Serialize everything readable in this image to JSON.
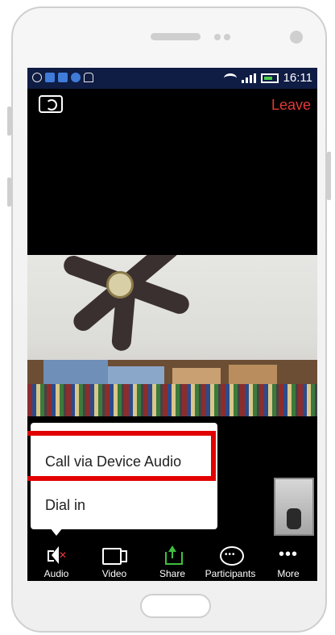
{
  "status_bar": {
    "time": "16:11"
  },
  "header": {
    "leave_label": "Leave"
  },
  "audio_menu": {
    "call_device_audio": "Call via Device Audio",
    "dial_in": "Dial in"
  },
  "toolbar": {
    "audio": "Audio",
    "video": "Video",
    "share": "Share",
    "participants": "Participants",
    "more": "More"
  },
  "icons": {
    "switch_camera": "camera-switch-icon",
    "audio": "speaker-muted-icon",
    "video": "video-camera-icon",
    "share": "share-upload-icon",
    "participants": "chat-bubble-icon",
    "more": "more-dots-icon"
  },
  "colors": {
    "leave": "#e53935",
    "share_accent": "#3fbf3f",
    "highlight": "#e20000",
    "status_bar": "#0f1c44"
  }
}
